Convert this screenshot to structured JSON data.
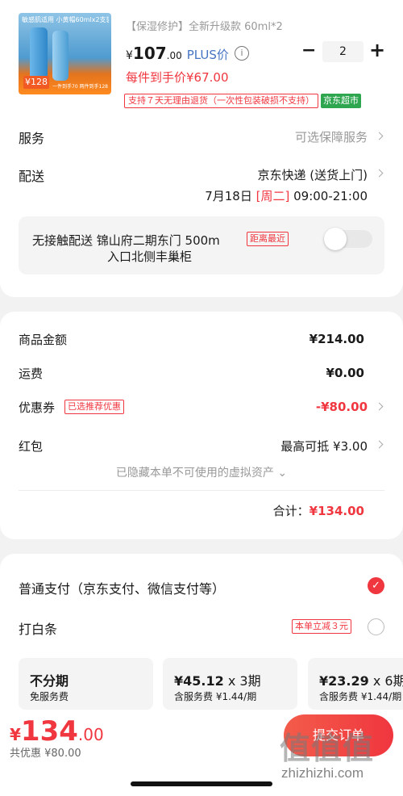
{
  "product": {
    "image_badge": "敏感肌适用 小黄帽60mlx2支装",
    "image_price": "¥128",
    "image_strip": "一件到手70 两件到手128",
    "title": "【保湿修护】全新升级款 60ml*2",
    "price_yen": "¥",
    "price_int": "107",
    "price_dec": ".00",
    "plus_label": "PLUS价",
    "info_icon": "i",
    "qty_minus": "−",
    "qty": "2",
    "qty_plus": "+",
    "unit_price": "每件到手价¥67.00",
    "return_tag": "支持７天无理由退货（一次性包装破损不支持）",
    "market_tag": "京东超市"
  },
  "service": {
    "label": "服务",
    "value": "可选保障服务"
  },
  "delivery": {
    "label": "配送",
    "value": "京东快递 (送货上门)",
    "date": "7月18日",
    "weekday": "[周二]",
    "time": "09:00-21:00"
  },
  "contactless": {
    "line1": "无接触配送  锦山府二期东门 500m",
    "near_tag": "距离最近",
    "line2": "入口北侧丰巢柜",
    "enabled": false
  },
  "costs": {
    "goods_label": "商品金额",
    "goods_value": "¥214.00",
    "shipping_label": "运费",
    "shipping_value": "¥0.00",
    "coupon_label": "优惠券",
    "coupon_badge": "已选推荐优惠",
    "coupon_value": "-¥80.00",
    "redpacket_label": "红包",
    "redpacket_value": "最高可抵 ¥3.00",
    "hidden_assets": "已隐藏本单不可使用的虚拟资产 ⌄",
    "total_label": "合计：",
    "total_value": "¥134.00"
  },
  "payment": {
    "normal_label": "普通支付（京东支付、微信支付等）",
    "check_icon": "✓",
    "baitiao_label": "打白条",
    "baitiao_tag": "本单立减３元",
    "installments": [
      {
        "title": "不分期",
        "count": "",
        "sub": "免服务费"
      },
      {
        "title": "¥45.12",
        "count": " x 3期",
        "sub": "含服务费 ¥1.44/期"
      },
      {
        "title": "¥23.29",
        "count": " x 6期",
        "sub": "含服务费 ¥1.44/期"
      }
    ]
  },
  "bottom": {
    "yen": "¥",
    "int": "134",
    "dec": ".00",
    "saved": "共优惠 ¥80.00",
    "submit": "提交订单",
    "watermark_logo": "值值值",
    "watermark_url": "zhizhizhi.com"
  },
  "colors": {
    "accent": "#f0363f",
    "plus_blue": "#4674c4",
    "market_green": "#2ea650"
  }
}
